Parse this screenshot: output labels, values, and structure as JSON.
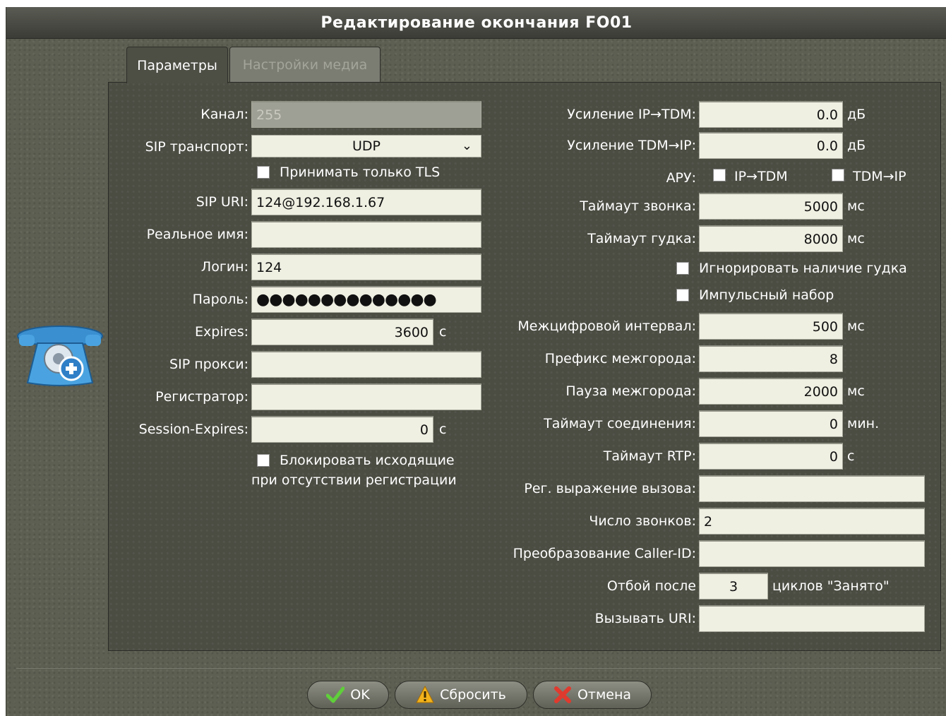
{
  "title": "Редактирование окончания FO01",
  "tabs": [
    {
      "label": "Параметры",
      "active": true
    },
    {
      "label": "Настройки медиа",
      "active": false
    }
  ],
  "left": {
    "channel": {
      "label": "Канал:",
      "value": "255"
    },
    "sip_transport": {
      "label": "SIP транспорт:",
      "value": "UDP"
    },
    "tls_only": {
      "label": "Принимать только TLS",
      "checked": false
    },
    "sip_uri": {
      "label": "SIP URI:",
      "value": "124@192.168.1.67"
    },
    "real_name": {
      "label": "Реальное имя:",
      "value": ""
    },
    "login": {
      "label": "Логин:",
      "value": "124"
    },
    "password": {
      "label": "Пароль:",
      "value": "●●●●●●●●●●●●●●"
    },
    "expires": {
      "label": "Expires:",
      "value": "3600",
      "unit": "с"
    },
    "sip_proxy": {
      "label": "SIP прокси:",
      "value": ""
    },
    "registrar": {
      "label": "Регистратор:",
      "value": ""
    },
    "session_expires": {
      "label": "Session-Expires:",
      "value": "0",
      "unit": "с"
    },
    "block_outgoing": {
      "label_line1": "Блокировать исходящие",
      "label_line2": "при отсутствии регистрации",
      "checked": false
    }
  },
  "right": {
    "gain_ip_tdm": {
      "label": "Усиление IP→TDM:",
      "value": "0.0",
      "unit": "дБ"
    },
    "gain_tdm_ip": {
      "label": "Усиление TDM→IP:",
      "value": "0.0",
      "unit": "дБ"
    },
    "agc": {
      "label": "АРУ:",
      "opt1": "IP→TDM",
      "opt2": "TDM→IP"
    },
    "ring_timeout": {
      "label": "Таймаут звонка:",
      "value": "5000",
      "unit": "мс"
    },
    "tone_timeout": {
      "label": "Таймаут гудка:",
      "value": "8000",
      "unit": "мс"
    },
    "ignore_tone": {
      "label": "Игнорировать наличие гудка",
      "checked": false
    },
    "pulse_dial": {
      "label": "Импульсный набор",
      "checked": false
    },
    "interdigit": {
      "label": "Межцифровой интервал:",
      "value": "500",
      "unit": "мс"
    },
    "ld_prefix": {
      "label": "Префикс межгорода:",
      "value": "8"
    },
    "ld_pause": {
      "label": "Пауза межгорода:",
      "value": "2000",
      "unit": "мс"
    },
    "conn_timeout": {
      "label": "Таймаут соединения:",
      "value": "0",
      "unit": "мин."
    },
    "rtp_timeout": {
      "label": "Таймаут RTP:",
      "value": "0",
      "unit": "с"
    },
    "call_regex": {
      "label": "Рег. выражение вызова:",
      "value": ""
    },
    "ring_count": {
      "label": "Число звонков:",
      "value": "2"
    },
    "callerid_transform": {
      "label": "Преобразование Caller-ID:",
      "value": ""
    },
    "hangup_after": {
      "label": "Отбой после",
      "value": "3",
      "unit": "циклов \"Занято\""
    },
    "call_uri": {
      "label": "Вызывать URI:",
      "value": ""
    }
  },
  "buttons": {
    "ok": "OK",
    "reset": "Сбросить",
    "cancel": "Отмена"
  },
  "icons": {
    "endpoint": "phone-add-icon",
    "ok": "checkmark-icon",
    "reset": "warning-icon",
    "cancel": "x-icon"
  }
}
